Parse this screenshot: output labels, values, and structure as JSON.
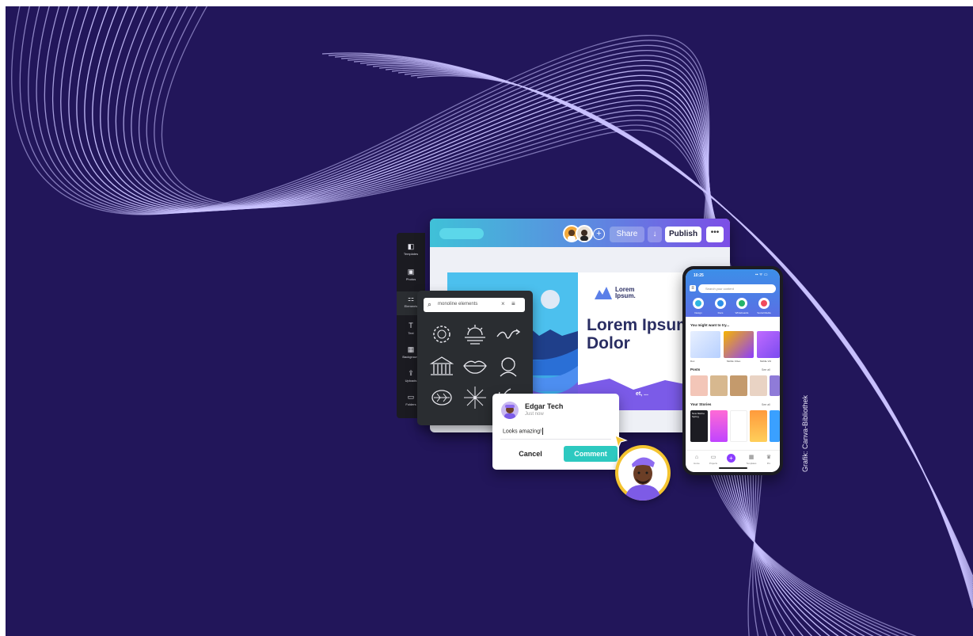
{
  "sidebar": {
    "items": [
      {
        "label": "Templates",
        "icon": "templates-icon"
      },
      {
        "label": "Photos",
        "icon": "photos-icon"
      },
      {
        "label": "Elements",
        "icon": "elements-icon"
      },
      {
        "label": "Text",
        "icon": "text-icon"
      },
      {
        "label": "Background",
        "icon": "background-icon"
      },
      {
        "label": "Uploads",
        "icon": "uploads-icon"
      },
      {
        "label": "Folders",
        "icon": "folders-icon"
      }
    ]
  },
  "toolbar": {
    "add_label": "+",
    "share_label": "Share",
    "download_label": "↓",
    "publish_label": "Publish",
    "more_label": "•••"
  },
  "design": {
    "logo_text": "Lorem Ipsum.",
    "title": "Lorem Ipsum Dolor",
    "footer_text": "et, ..."
  },
  "elements_panel": {
    "search_value": "monoline elements",
    "clear_label": "×",
    "filter_label": "≡"
  },
  "comment": {
    "author": "Edgar Tech",
    "time": "Just now",
    "text": "Looks amazing!",
    "cancel_label": "Cancel",
    "submit_label": "Comment"
  },
  "phone": {
    "time": "10:25",
    "status": "▪▪ ᯤ ▭",
    "search_placeholder": "Search your content",
    "categories": [
      "Design",
      "Docs",
      "Whiteboards",
      "Social Media"
    ],
    "section_try": "You might want to try...",
    "try_captions": [
      "Doc",
      "Mobile Video",
      "Mobile Vid"
    ],
    "section_posts": "Posts",
    "section_stories": "Your Stories",
    "see_all": "See all",
    "story_text": "Now Marine Spring",
    "nav": [
      "Home",
      "Projects",
      "",
      "Templates",
      "Pro"
    ]
  },
  "credit": "Grafik: Canva-Bibliothek",
  "colors": {
    "background": "#22165a",
    "wave": "#c9c2ff",
    "accent_teal": "#2dc9c0",
    "accent_purple": "#8b3dff",
    "avatar_ring": "#f4c430"
  }
}
